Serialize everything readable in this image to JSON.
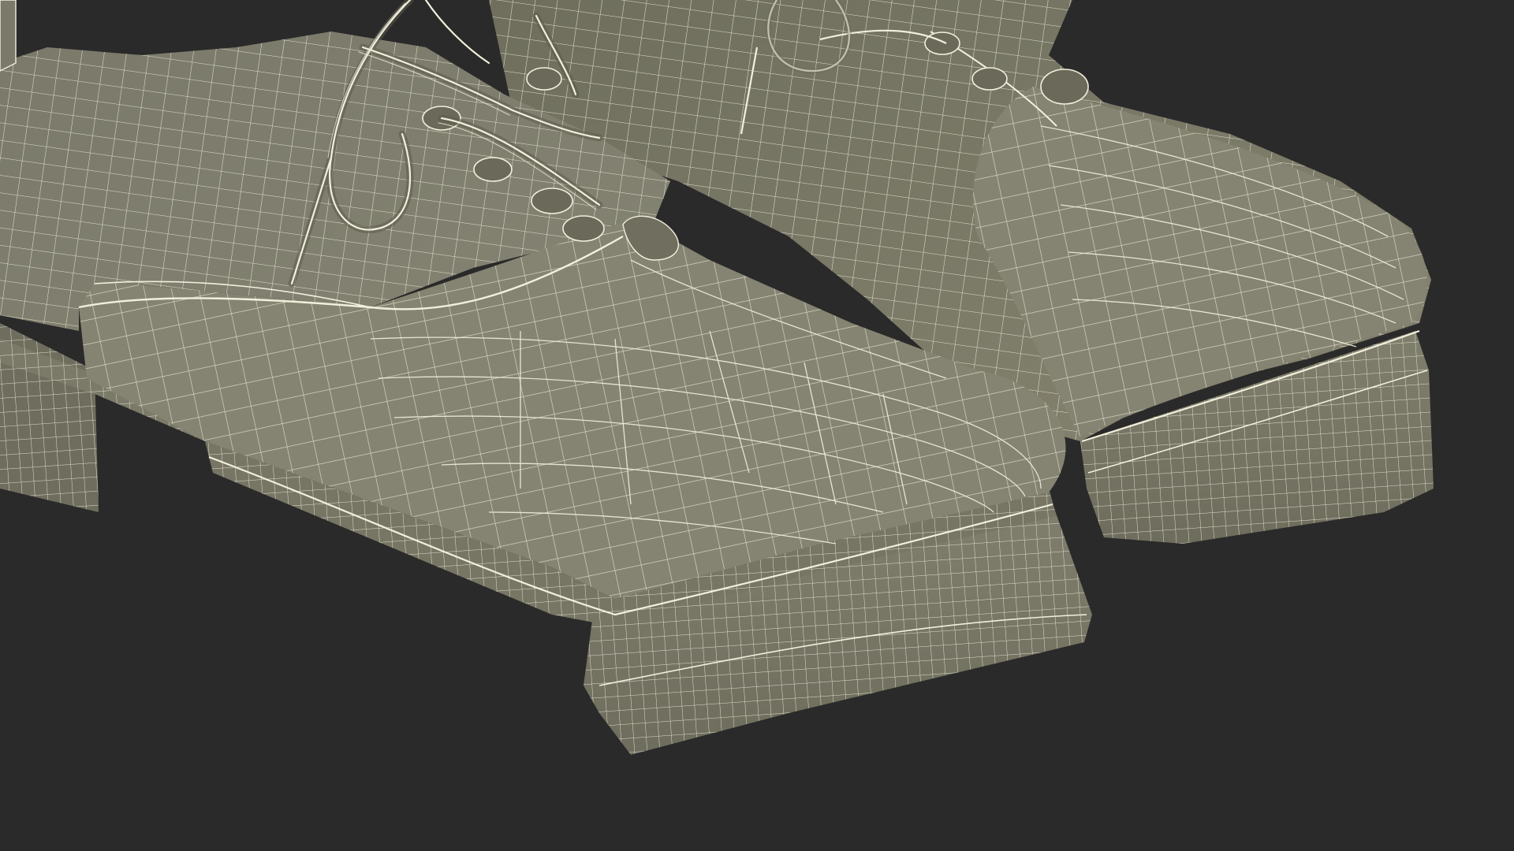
{
  "scene": {
    "subject": "wireframe-shoes",
    "colors": {
      "background": "#2a2a2a",
      "surface": "#7d7c6b",
      "surface_dark": "#5f5e50",
      "surface_light": "#8b8a78",
      "shadow": "#4a493f",
      "wire": "#f2efdc"
    }
  }
}
